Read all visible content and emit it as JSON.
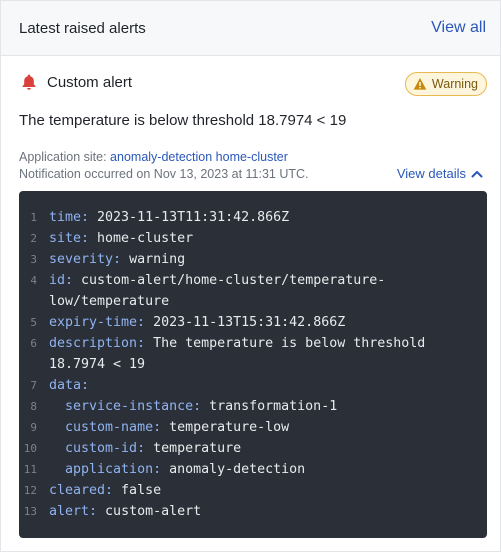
{
  "header": {
    "title": "Latest raised alerts",
    "view_all_label": "View all"
  },
  "alert": {
    "name": "Custom alert",
    "severity_badge": "Warning",
    "message": "The temperature is below threshold 18.7974 < 19",
    "application_site_label": "Application site:",
    "application_site_value": "anomaly-detection home-cluster",
    "notification_text": "Notification occurred on Nov 13, 2023 at 11:31 UTC.",
    "view_details_label": "View details"
  },
  "code_lines": [
    {
      "n": "1",
      "key": "time:",
      "value": " 2023-11-13T11:31:42.866Z"
    },
    {
      "n": "2",
      "key": "site:",
      "value": " home-cluster"
    },
    {
      "n": "3",
      "key": "severity:",
      "value": " warning"
    },
    {
      "n": "4",
      "key": "id:",
      "value": " custom-alert/home-cluster/temperature-\nlow/temperature"
    },
    {
      "n": "5",
      "key": "expiry-time:",
      "value": " 2023-11-13T15:31:42.866Z"
    },
    {
      "n": "6",
      "key": "description:",
      "value": " The temperature is below threshold\n18.7974 < 19"
    },
    {
      "n": "7",
      "key": "data:",
      "value": ""
    },
    {
      "n": "8",
      "key": "  service-instance:",
      "value": " transformation-1"
    },
    {
      "n": "9",
      "key": "  custom-name:",
      "value": " temperature-low"
    },
    {
      "n": "10",
      "key": "  custom-id:",
      "value": " temperature"
    },
    {
      "n": "11",
      "key": "  application:",
      "value": " anomaly-detection"
    },
    {
      "n": "12",
      "key": "cleared:",
      "value": " false"
    },
    {
      "n": "13",
      "key": "alert:",
      "value": " custom-alert"
    }
  ],
  "colors": {
    "accent_link": "#2a57b8",
    "bell": "#d9413a",
    "warning": "#e7b94f",
    "code_bg": "#2b2f37"
  },
  "icons": {
    "bell": "bell-icon",
    "warning": "warning-triangle-icon",
    "chevron": "chevron-up-icon"
  }
}
